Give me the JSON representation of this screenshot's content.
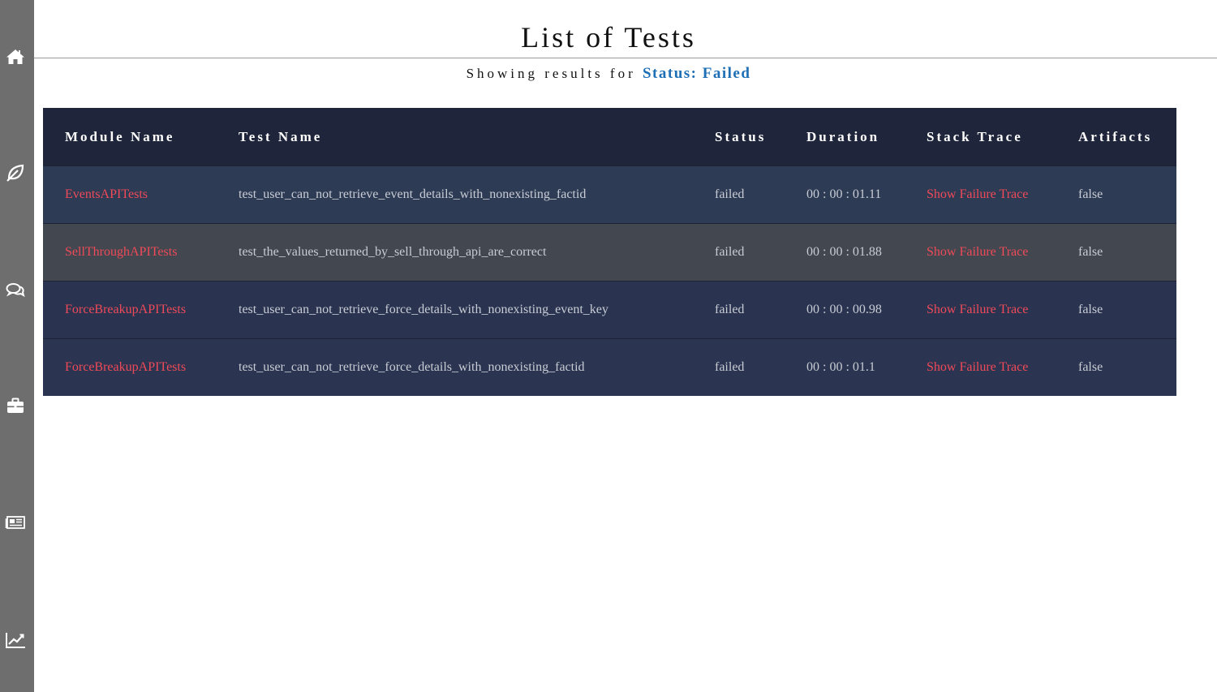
{
  "page": {
    "title": "List of Tests",
    "subtitle_prefix": "Showing results for",
    "subtitle_filter": "Status: Failed"
  },
  "sidebar": {
    "icons": [
      "home-icon",
      "leaf-icon",
      "comments-icon",
      "briefcase-icon",
      "newspaper-icon",
      "line-chart-icon"
    ]
  },
  "table": {
    "headers": {
      "module": "Module Name",
      "test": "Test Name",
      "status": "Status",
      "duration": "Duration",
      "trace": "Stack Trace",
      "artifacts": "Artifacts"
    },
    "rows": [
      {
        "module": "EventsAPITests",
        "test": "test_user_can_not_retrieve_event_details_with_nonexisting_factid",
        "status": "failed",
        "duration": "00 : 00 : 01.11",
        "trace": "Show Failure Trace",
        "artifacts": "false"
      },
      {
        "module": "SellThroughAPITests",
        "test": "test_the_values_returned_by_sell_through_api_are_correct",
        "status": "failed",
        "duration": "00 : 00 : 01.88",
        "trace": "Show Failure Trace",
        "artifacts": "false"
      },
      {
        "module": "ForceBreakupAPITests",
        "test": "test_user_can_not_retrieve_force_details_with_nonexisting_event_key",
        "status": "failed",
        "duration": "00 : 00 : 00.98",
        "trace": "Show Failure Trace",
        "artifacts": "false"
      },
      {
        "module": "ForceBreakupAPITests",
        "test": "test_user_can_not_retrieve_force_details_with_nonexisting_factid",
        "status": "failed",
        "duration": "00 : 00 : 01.1",
        "trace": "Show Failure Trace",
        "artifacts": "false"
      }
    ]
  },
  "colors": {
    "sidebar": "#6e6e6e",
    "header": "#1f263b",
    "link": "#f04a58",
    "filter": "#1e6fb5"
  }
}
